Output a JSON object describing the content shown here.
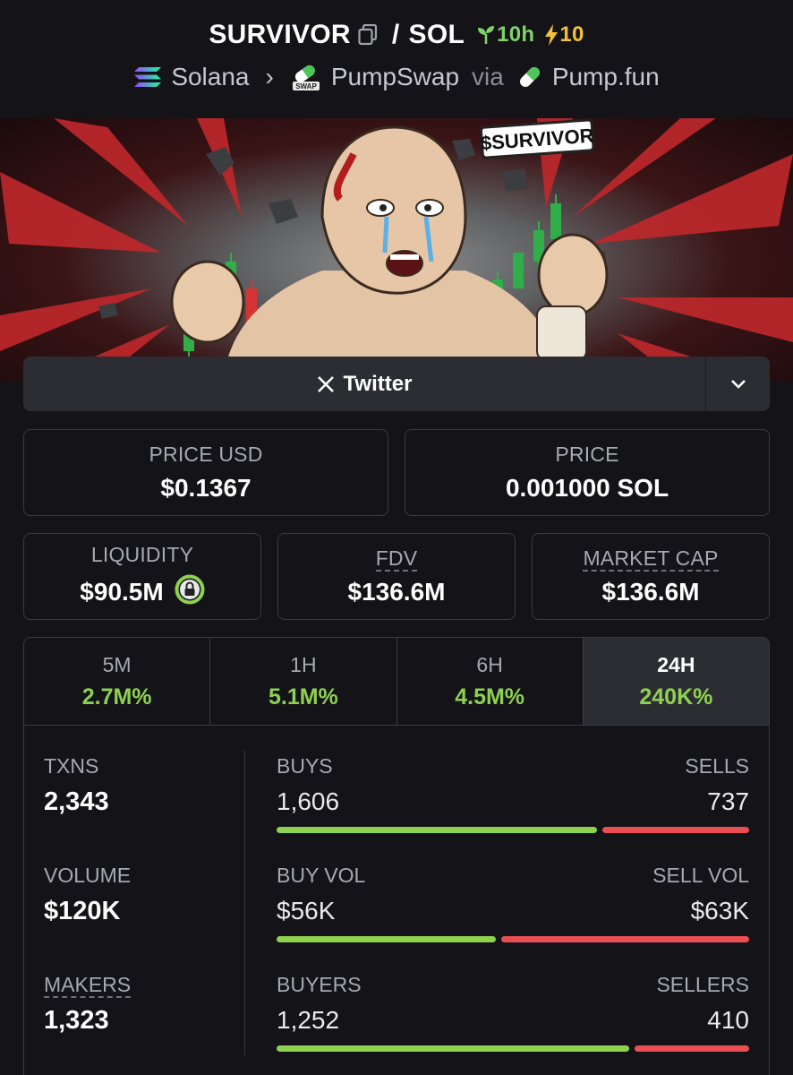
{
  "header": {
    "token": "SURVIVOR",
    "quote": "SOL",
    "age": "10h",
    "boosts": "10",
    "chain": "Solana",
    "dex": "PumpSwap",
    "via": "via",
    "launchpad": "Pump.fun"
  },
  "banner": {
    "tag": "$SURVIVOR"
  },
  "social": {
    "twitter_label": "Twitter"
  },
  "prices": {
    "usd_label": "PRICE USD",
    "usd_value": "$0.1367",
    "native_label": "PRICE",
    "native_value": "0.001000 SOL"
  },
  "metrics": {
    "liquidity_label": "LIQUIDITY",
    "liquidity_value": "$90.5M",
    "fdv_label": "FDV",
    "fdv_value": "$136.6M",
    "mcap_label": "MARKET CAP",
    "mcap_value": "$136.6M"
  },
  "tabs": [
    {
      "label": "5M",
      "value": "2.7M%"
    },
    {
      "label": "1H",
      "value": "5.1M%"
    },
    {
      "label": "6H",
      "value": "4.5M%"
    },
    {
      "label": "24H",
      "value": "240K%"
    }
  ],
  "stats": {
    "txns_label": "TXNS",
    "txns_value": "2,343",
    "volume_label": "VOLUME",
    "volume_value": "$120K",
    "makers_label": "MAKERS",
    "makers_value": "1,323",
    "buys_label": "BUYS",
    "buys_value": "1,606",
    "sells_label": "SELLS",
    "sells_value": "737",
    "buys_ratio": 0.685,
    "buyvol_label": "BUY VOL",
    "buyvol_value": "$56K",
    "sellvol_label": "SELL VOL",
    "sellvol_value": "$63K",
    "buyvol_ratio": 0.47,
    "buyers_label": "BUYERS",
    "buyers_value": "1,252",
    "sellers_label": "SELLERS",
    "sellers_value": "410",
    "buyers_ratio": 0.755
  },
  "colors": {
    "green": "#8ed14f",
    "red": "#ea4e52",
    "yellow": "#f2c13a",
    "bg": "#131318"
  }
}
